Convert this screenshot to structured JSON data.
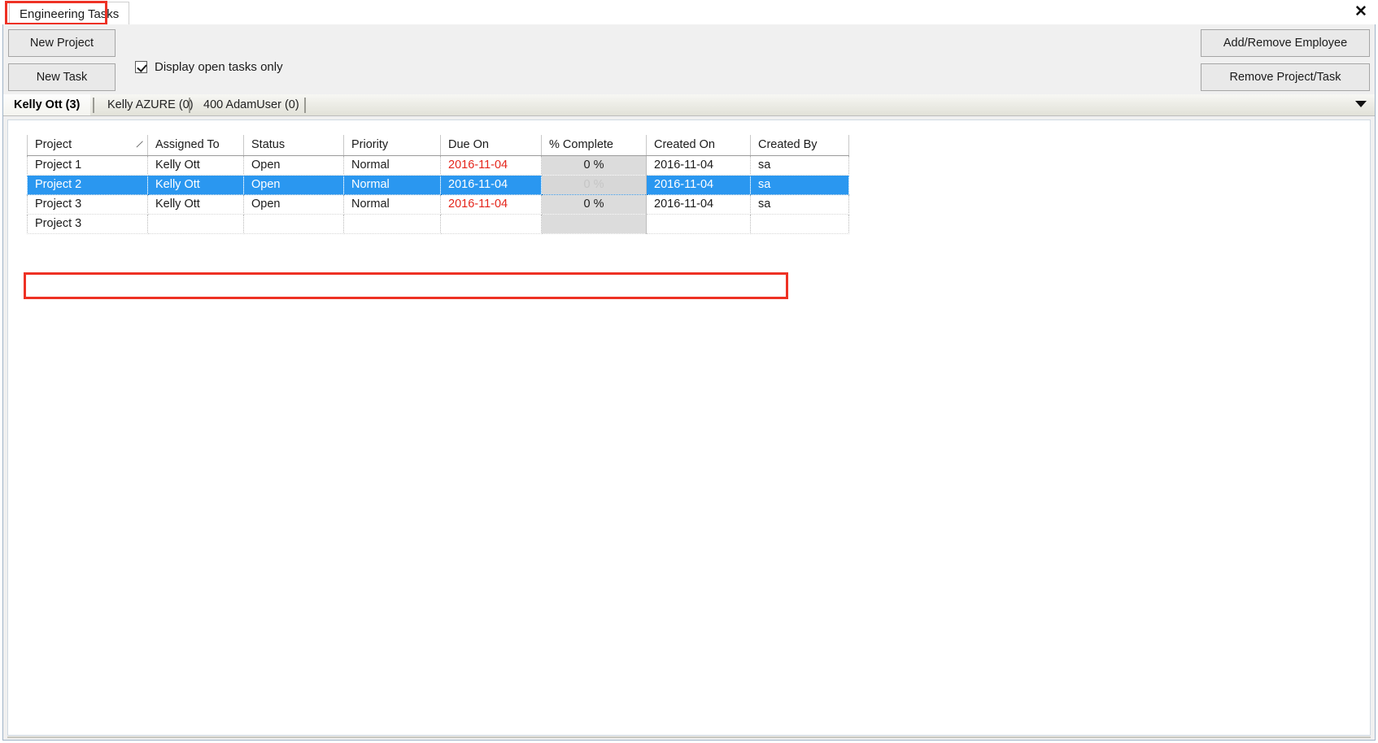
{
  "window": {
    "document_tab": "Engineering Tasks",
    "close_label": "✕"
  },
  "toolbar": {
    "new_project_label": "New Project",
    "new_task_label": "New Task",
    "add_remove_employee_label": "Add/Remove Employee",
    "remove_project_task_label": "Remove Project/Task",
    "display_open_only_label": "Display open tasks only",
    "display_open_only_checked": true
  },
  "tabs": {
    "items": [
      {
        "label": "Kelly Ott (3)",
        "active": true
      },
      {
        "label": "Kelly AZURE (0)",
        "active": false
      },
      {
        "label": "400 AdamUser (0)",
        "active": false
      }
    ],
    "overflow_icon": "chevron-down-icon"
  },
  "grid": {
    "sort_column": "Project",
    "sort_indicator": "⁄",
    "columns": [
      "Project",
      "Assigned To",
      "Status",
      "Priority",
      "Due On",
      "% Complete",
      "Created On",
      "Created By"
    ],
    "rows": [
      {
        "project": "Project 1",
        "assigned_to": "Kelly Ott",
        "status": "Open",
        "priority": "Normal",
        "due_on": "2016-11-04",
        "due_overdue": true,
        "percent_complete": "0 %",
        "created_on": "2016-11-04",
        "created_by": "sa",
        "selected": false
      },
      {
        "project": "Project 2",
        "assigned_to": "Kelly Ott",
        "status": "Open",
        "priority": "Normal",
        "due_on": "2016-11-04",
        "due_overdue": false,
        "percent_complete": "0 %",
        "created_on": "2016-11-04",
        "created_by": "sa",
        "selected": true
      },
      {
        "project": "Project 3",
        "assigned_to": "Kelly Ott",
        "status": "Open",
        "priority": "Normal",
        "due_on": "2016-11-04",
        "due_overdue": true,
        "percent_complete": "0 %",
        "created_on": "2016-11-04",
        "created_by": "sa",
        "selected": false
      },
      {
        "project": "Project 3",
        "assigned_to": "",
        "status": "",
        "priority": "",
        "due_on": "",
        "due_overdue": false,
        "percent_complete": "",
        "created_on": "",
        "created_by": "",
        "selected": false
      }
    ]
  },
  "colors": {
    "highlight_red": "#ee3124",
    "selection_blue": "#2a97f0",
    "overdue_red": "#e4251b",
    "panel_gray": "#f0f0f0"
  }
}
